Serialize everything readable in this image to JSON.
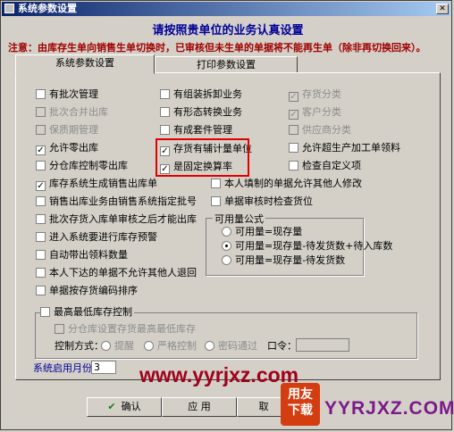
{
  "window": {
    "title": "系统参数设置"
  },
  "heading": "请按照贵单位的业务认真设置",
  "note": "注意：由库存生单向销售生单切换时，已审核但未生单的单据将不能再生单（除非再切换回来）。",
  "tabs": [
    "系统参数设置",
    "打印参数设置"
  ],
  "col1": [
    {
      "label": "有批次管理",
      "checked": false,
      "disabled": false
    },
    {
      "label": "批次合并出库",
      "checked": false,
      "disabled": true
    },
    {
      "label": "保质期管理",
      "checked": false,
      "disabled": true
    },
    {
      "label": "允许零出库",
      "checked": true,
      "disabled": false
    },
    {
      "label": "分仓库控制零出库",
      "checked": false,
      "disabled": false
    },
    {
      "label": "库存系统生成销售出库单",
      "checked": true,
      "disabled": false
    },
    {
      "label": "销售出库业务由销售系统指定批号",
      "checked": false,
      "disabled": false
    },
    {
      "label": "批次存货入库单审核之后才能出库",
      "checked": false,
      "disabled": false
    },
    {
      "label": "进入系统要进行库存预警",
      "checked": false,
      "disabled": false
    },
    {
      "label": "自动带出领料数量",
      "checked": false,
      "disabled": false
    },
    {
      "label": "本人下达的单据不允许其他人退回",
      "checked": false,
      "disabled": false
    },
    {
      "label": "单据按存货编码排序",
      "checked": false,
      "disabled": false
    }
  ],
  "col2": [
    {
      "label": "有组装拆卸业务",
      "checked": false,
      "disabled": false
    },
    {
      "label": "有形态转换业务",
      "checked": false,
      "disabled": false
    },
    {
      "label": "有成套件管理",
      "checked": false,
      "disabled": false
    },
    {
      "label": "存货有辅计量单位",
      "checked": true,
      "disabled": false
    },
    {
      "label": "是固定换算率",
      "checked": true,
      "disabled": false
    },
    {
      "label": "本人填制的单据允许其他人修改",
      "checked": false,
      "disabled": false
    },
    {
      "label": "单据审核时检查货位",
      "checked": false,
      "disabled": false
    }
  ],
  "col3": [
    {
      "label": "存货分类",
      "checked": true,
      "disabled": true
    },
    {
      "label": "客户分类",
      "checked": true,
      "disabled": true
    },
    {
      "label": "供应商分类",
      "checked": false,
      "disabled": true
    },
    {
      "label": "允许超生产加工单领料",
      "checked": false,
      "disabled": false
    },
    {
      "label": "检查自定义项",
      "checked": false,
      "disabled": false
    }
  ],
  "available_formula": {
    "title": "可用量公式",
    "options": [
      "可用量=现存量",
      "可用量=现存量-待发货数+待入库数",
      "可用量=现存量-待发货数"
    ],
    "selected": 1
  },
  "min_stock": {
    "label": "最高最低库存控制",
    "checked": false,
    "sub_label": "分仓库设置存货最高最低库存",
    "control_label": "控制方式：",
    "options": [
      "提醒",
      "严格控制",
      "密码通过"
    ],
    "password_label": "口令："
  },
  "start_month": {
    "label": "系统启用月份：",
    "value": "3"
  },
  "buttons": {
    "ok": "确认",
    "apply": "应 用",
    "cancel": "取"
  },
  "watermark": {
    "url": "www.yyrjxz.com",
    "logo_top": "用友",
    "logo_bottom": "下载",
    "brand": "YYRJXZ.COM"
  },
  "colors": {
    "titlebar": "#0a246a",
    "heading": "#00009a",
    "note": "#a00000",
    "highlight": "#e00000"
  }
}
